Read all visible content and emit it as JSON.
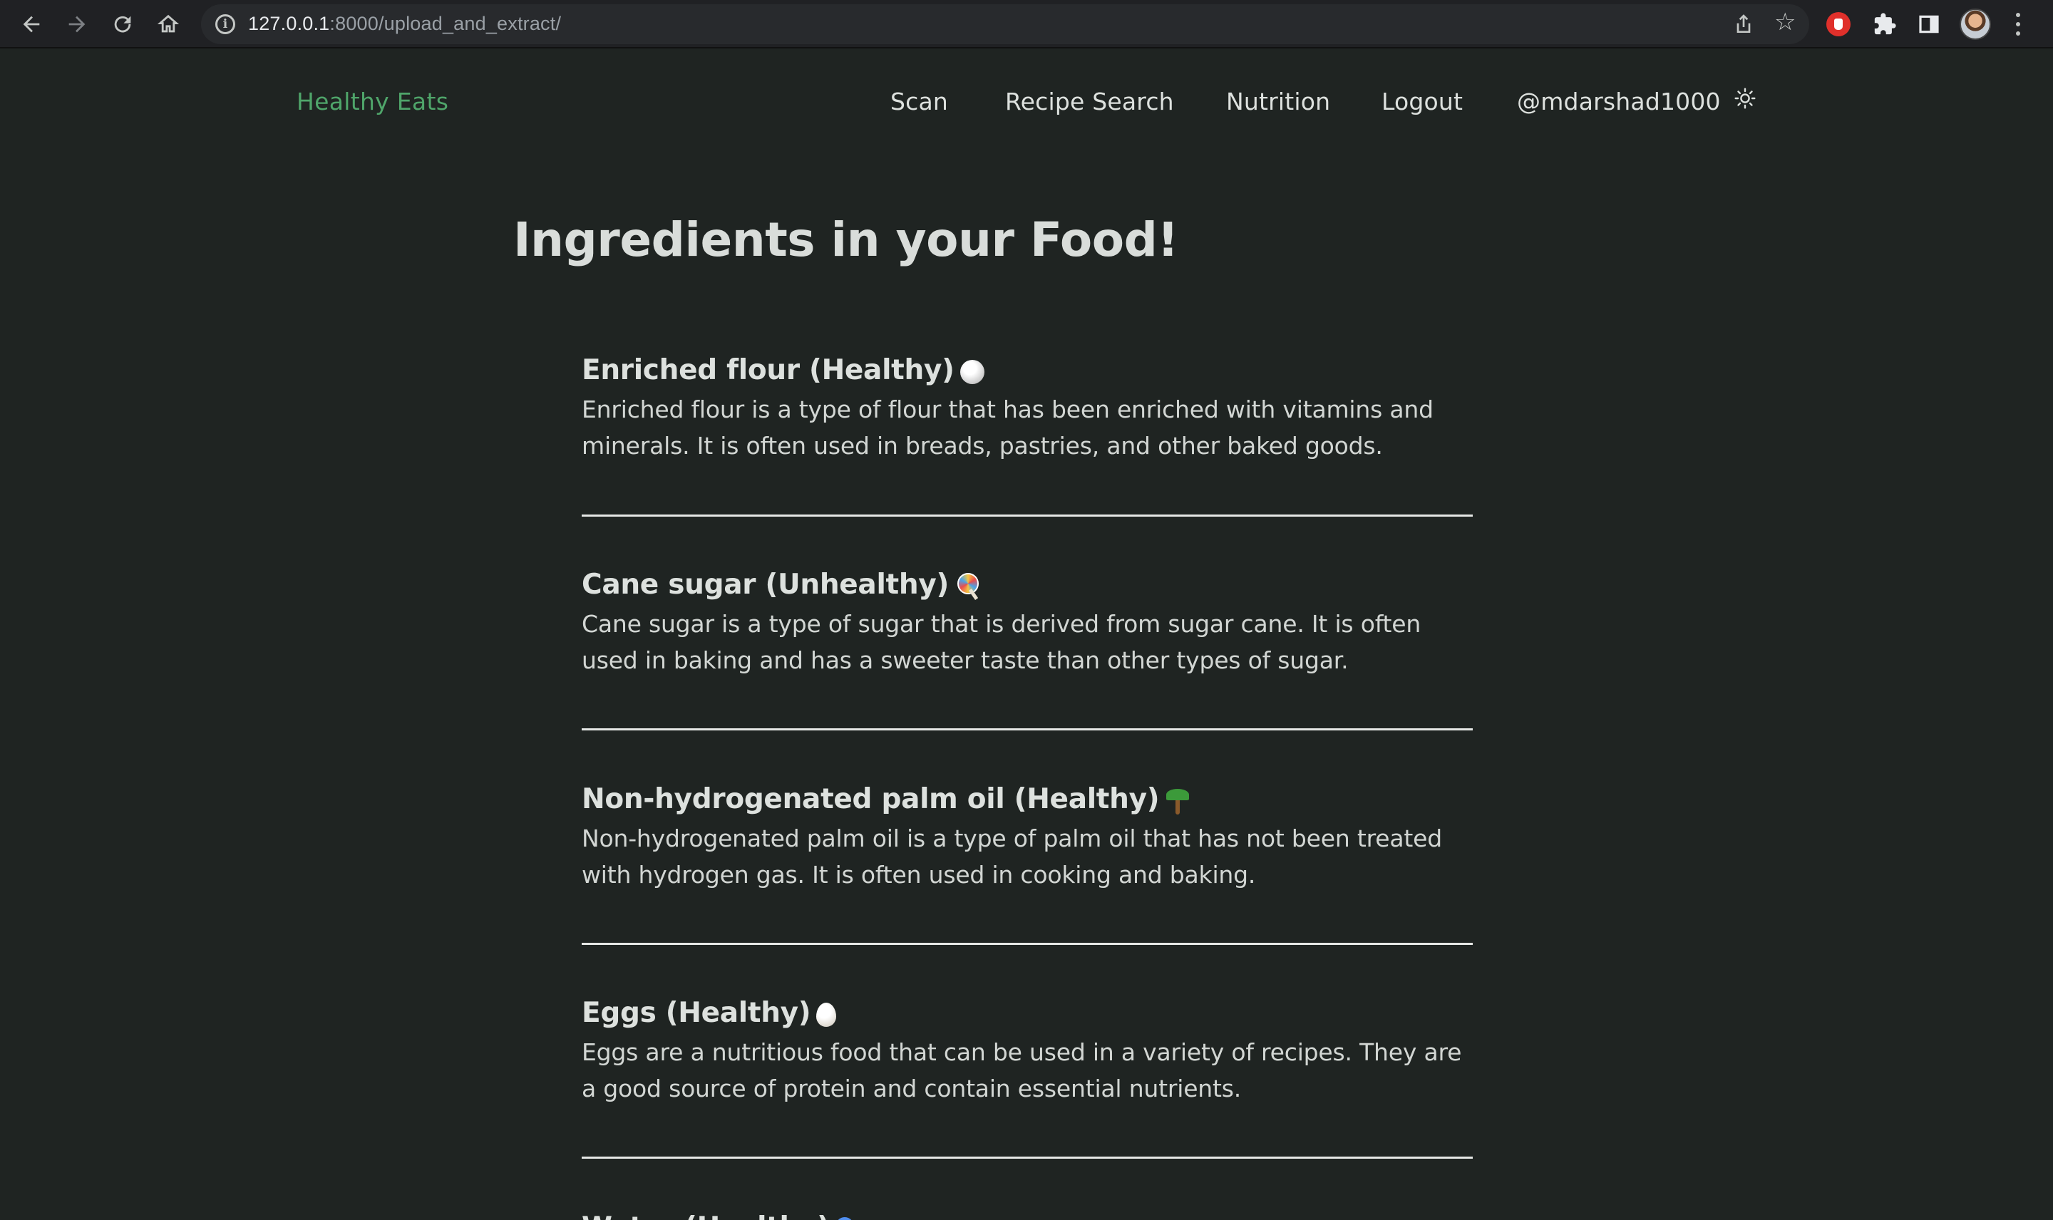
{
  "browser": {
    "url_host": "127.0.0.1",
    "url_path": ":8000/upload_and_extract/"
  },
  "nav": {
    "brand": "Healthy Eats",
    "links": [
      "Scan",
      "Recipe Search",
      "Nutrition",
      "Logout"
    ],
    "username": "@mdarshad1000",
    "brand_color": "#4fa56a"
  },
  "page": {
    "title": "Ingredients in your Food!"
  },
  "ingredients": [
    {
      "name": "Enriched flour (Healthy)",
      "icon": "flour-icon",
      "description": "Enriched flour is a type of flour that has been enriched with vitamins and minerals. It is often used in breads, pastries, and other baked goods."
    },
    {
      "name": "Cane sugar (Unhealthy)",
      "icon": "lollipop-icon",
      "description": "Cane sugar is a type of sugar that is derived from sugar cane. It is often used in baking and has a sweeter taste than other types of sugar."
    },
    {
      "name": "Non-hydrogenated palm oil (Healthy)",
      "icon": "palm-tree-icon",
      "description": "Non-hydrogenated palm oil is a type of palm oil that has not been treated with hydrogen gas. It is often used in cooking and baking."
    },
    {
      "name": "Eggs (Healthy)",
      "icon": "egg-icon",
      "description": "Eggs are a nutritious food that can be used in a variety of recipes. They are a good source of protein and contain essential nutrients."
    },
    {
      "name": "Water (Healthy)",
      "icon": "water-drop-icon",
      "description": ""
    }
  ]
}
